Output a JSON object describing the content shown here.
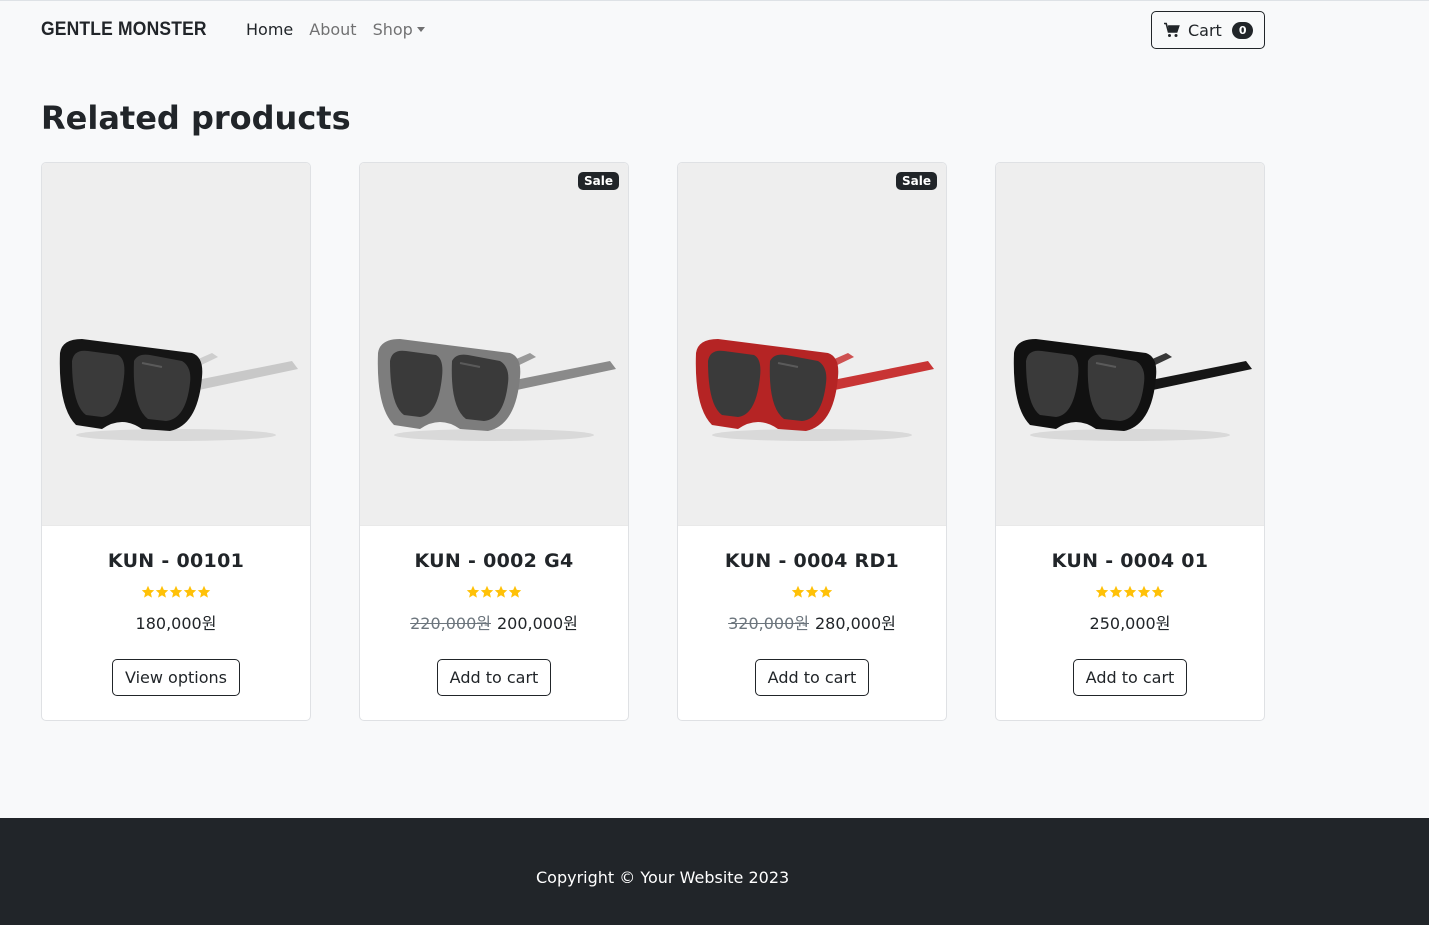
{
  "navbar": {
    "brand": "GENTLE MONSTER",
    "links": [
      {
        "label": "Home",
        "active": true
      },
      {
        "label": "About",
        "active": false
      },
      {
        "label": "Shop",
        "active": false
      }
    ],
    "cart_label": "Cart",
    "cart_count": "0"
  },
  "section": {
    "title": "Related products"
  },
  "products": [
    {
      "name": "KUN - 00101",
      "rating": 5,
      "old_price": "",
      "price": "180,000원",
      "button": "View options",
      "sale": false,
      "frame_color": "#151515",
      "temple_color": "#c8c8c8"
    },
    {
      "name": "KUN - 0002 G4",
      "rating": 4,
      "old_price": "220,000원",
      "price": "200,000원",
      "button": "Add to cart",
      "sale": true,
      "sale_label": "Sale",
      "frame_color": "#7d7d7d",
      "temple_color": "#8a8a8a"
    },
    {
      "name": "KUN - 0004 RD1",
      "rating": 3,
      "old_price": "320,000원",
      "price": "280,000원",
      "button": "Add to cart",
      "sale": true,
      "sale_label": "Sale",
      "frame_color": "#b52424",
      "temple_color": "#c83434"
    },
    {
      "name": "KUN - 0004 01",
      "rating": 5,
      "old_price": "",
      "price": "250,000원",
      "button": "Add to cart",
      "sale": false,
      "frame_color": "#111111",
      "temple_color": "#161616"
    }
  ],
  "colors": {
    "star": "#ffc107",
    "dark": "#212529",
    "lens": "#3a3a3a"
  },
  "footer": {
    "text": "Copyright © Your Website 2023"
  }
}
